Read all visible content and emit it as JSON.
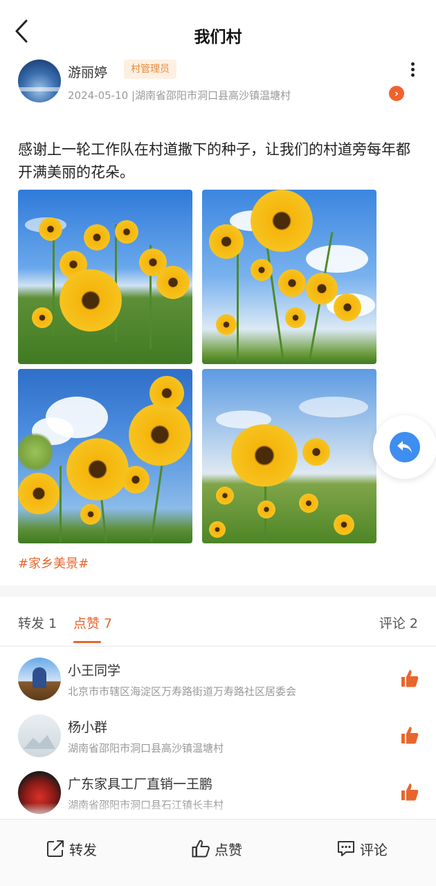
{
  "header": {
    "title": "我们村"
  },
  "author": {
    "name": "游丽婷",
    "role": "村管理员",
    "meta": "2024-05-10 |湖南省邵阳市洞口县高沙镇温塘村"
  },
  "post": {
    "text": "感谢上一轮工作队在村道撒下的种子，让我们的村道旁每年都开满美丽的花朵。",
    "topic": "#家乡美景#",
    "image_count": 4
  },
  "tabs": {
    "forward": "转发 1",
    "like": "点赞 7",
    "comment": "评论 2",
    "active": "like"
  },
  "likers": [
    {
      "name": "小王同学",
      "location": "北京市市辖区海淀区万寿路街道万寿路社区居委会"
    },
    {
      "name": "杨小群",
      "location": "湖南省邵阳市洞口县高沙镇温塘村"
    },
    {
      "name": "广东家具工厂直销一王鹏",
      "location": "湖南省邵阳市洞口县石江镇长丰村"
    }
  ],
  "bottom_bar": {
    "forward": "转发",
    "like": "点赞",
    "comment": "评论"
  },
  "colors": {
    "accent": "#e8662d",
    "float_button": "#3d8ef0"
  }
}
